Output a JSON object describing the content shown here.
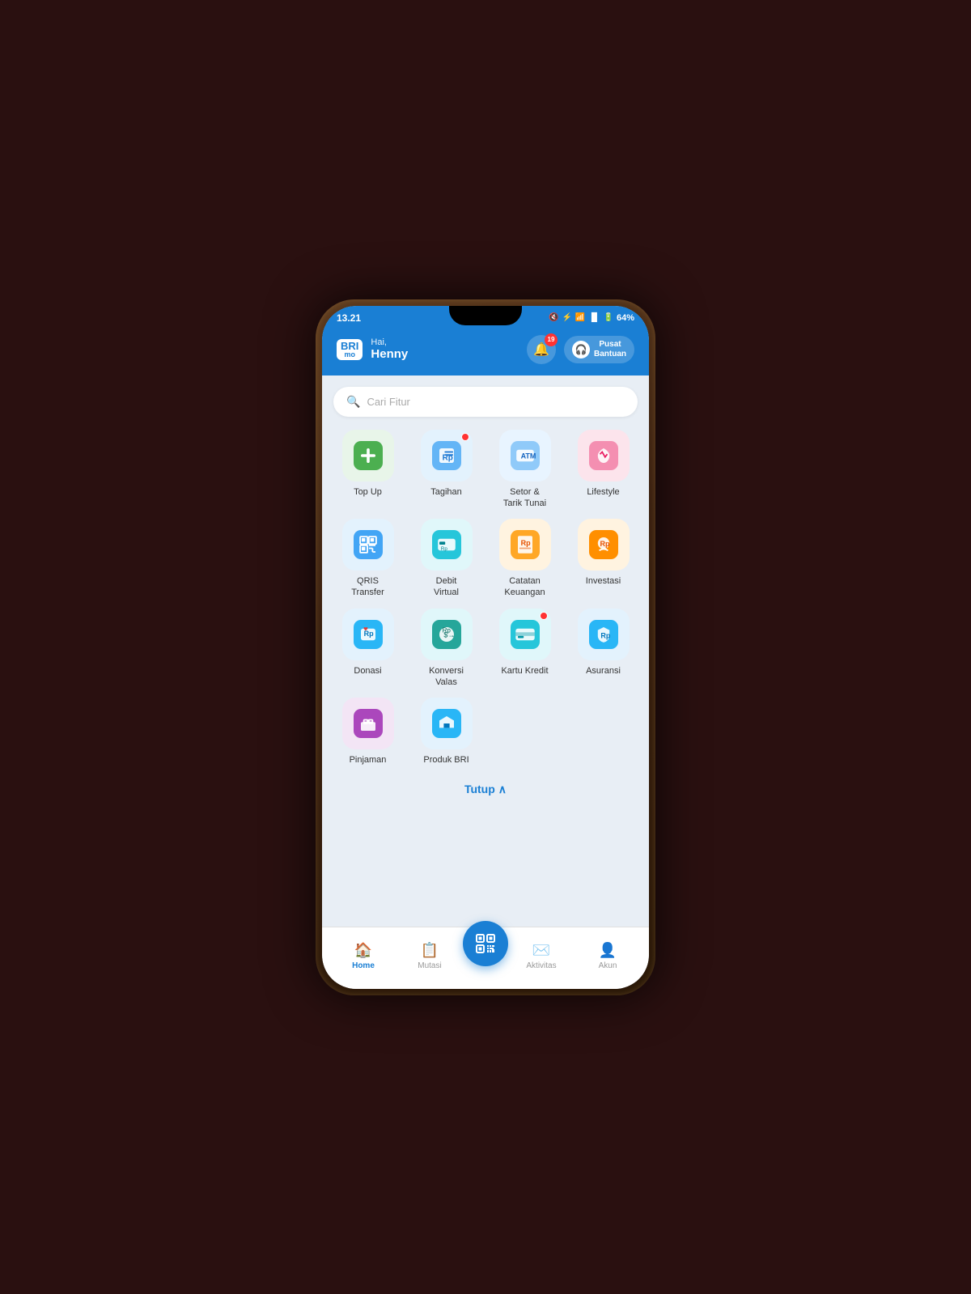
{
  "statusBar": {
    "time": "13.21",
    "battery": "64%",
    "signal": "●●●"
  },
  "header": {
    "brandTop": "BRI",
    "brandBottom": "mo",
    "greetingLabel": "Hai,",
    "userName": "Henny",
    "notifCount": "19",
    "supportLabel": "Pusat\nBantuan"
  },
  "search": {
    "placeholder": "Cari Fitur"
  },
  "features": [
    {
      "id": "top-up",
      "label": "Top Up",
      "color": "green",
      "hasDot": false
    },
    {
      "id": "tagihan",
      "label": "Tagihan",
      "color": "lightblue",
      "hasDot": true
    },
    {
      "id": "setor-tarik",
      "label": "Setor &\nTarik Tunai",
      "color": "white-blue",
      "hasDot": false
    },
    {
      "id": "lifestyle",
      "label": "Lifestyle",
      "color": "pink",
      "hasDot": false
    },
    {
      "id": "qris-transfer",
      "label": "QRIS\nTransfer",
      "color": "lightblue",
      "hasDot": false
    },
    {
      "id": "debit-virtual",
      "label": "Debit\nVirtual",
      "color": "lightblue",
      "hasDot": false
    },
    {
      "id": "catatan-keuangan",
      "label": "Catatan\nKeuangan",
      "color": "orange",
      "hasDot": false
    },
    {
      "id": "investasi",
      "label": "Investasi",
      "color": "orange",
      "hasDot": false
    },
    {
      "id": "donasi",
      "label": "Donasi",
      "color": "lightblue",
      "hasDot": false
    },
    {
      "id": "konversi-valas",
      "label": "Konversi\nValas",
      "color": "teal",
      "hasDot": false
    },
    {
      "id": "kartu-kredit",
      "label": "Kartu Kredit",
      "color": "teal",
      "hasDot": true
    },
    {
      "id": "asuransi",
      "label": "Asuransi",
      "color": "lightblue",
      "hasDot": false
    },
    {
      "id": "pinjaman",
      "label": "Pinjaman",
      "color": "white-blue",
      "hasDot": false
    },
    {
      "id": "produk-bri",
      "label": "Produk BRI",
      "color": "lightblue",
      "hasDot": false
    }
  ],
  "tutupLabel": "Tutup",
  "bottomNav": {
    "items": [
      {
        "id": "home",
        "label": "Home",
        "active": true
      },
      {
        "id": "mutasi",
        "label": "Mutasi",
        "active": false
      },
      {
        "id": "qris",
        "label": "",
        "active": false,
        "isCenter": true
      },
      {
        "id": "aktivitas",
        "label": "Aktivitas",
        "active": false
      },
      {
        "id": "akun",
        "label": "Akun",
        "active": false
      }
    ]
  }
}
